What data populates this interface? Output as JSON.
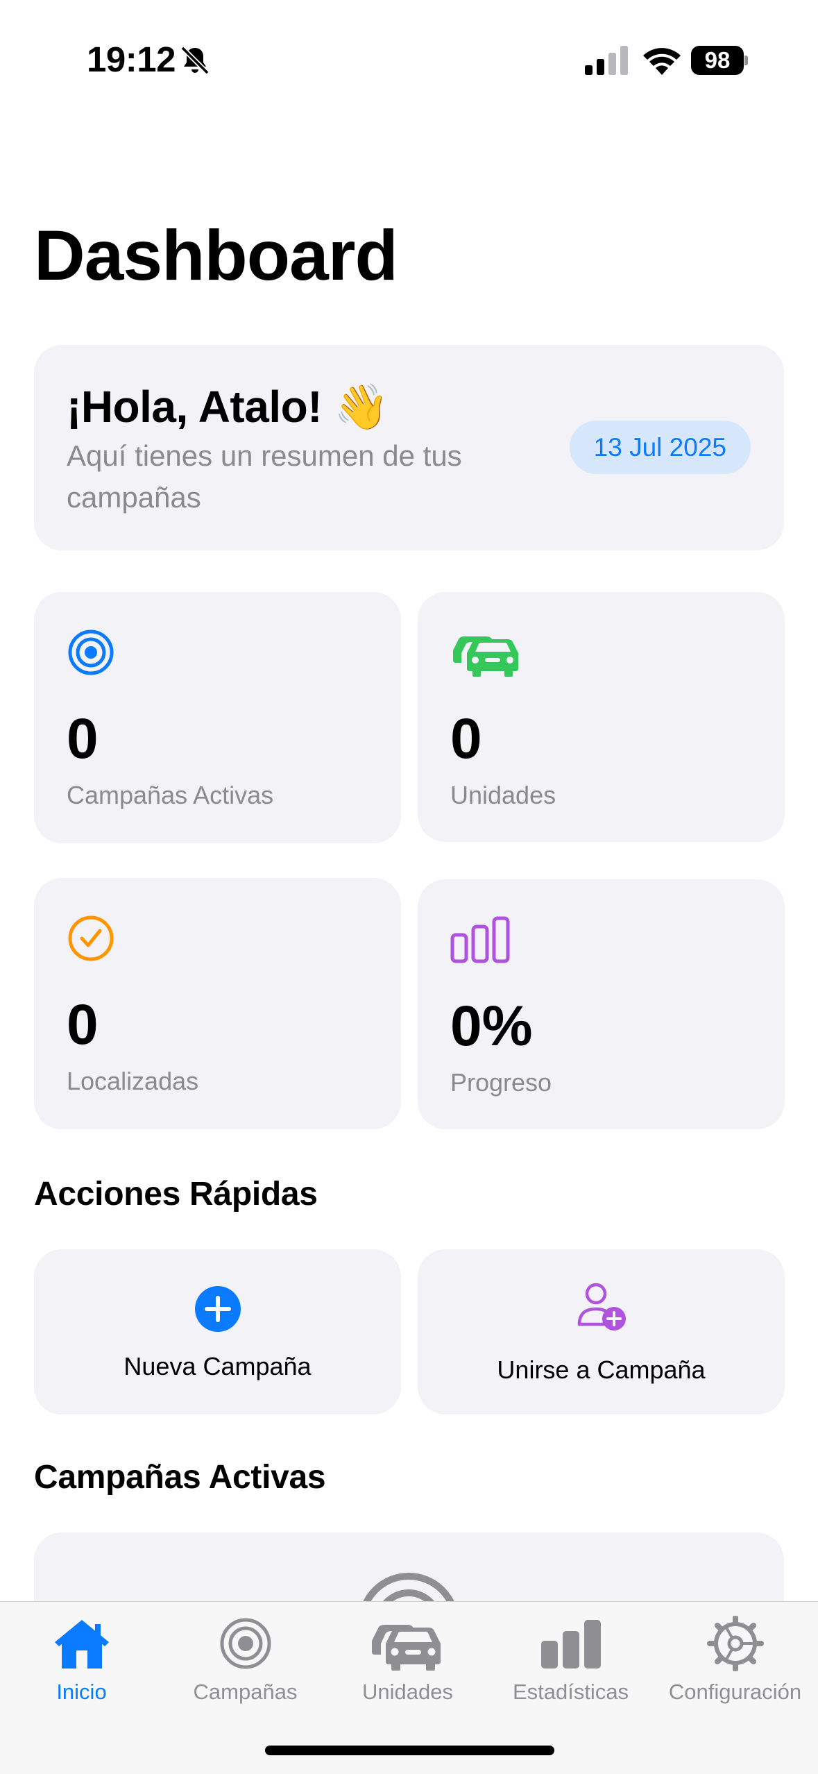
{
  "status_bar": {
    "time": "19:12",
    "battery": "98"
  },
  "title": "Dashboard",
  "greeting": {
    "title": "¡Hola, Atalo! 👋",
    "subtitle": "Aquí tienes un resumen de tus campañas",
    "date": "13 Jul 2025"
  },
  "stats": [
    {
      "value": "0",
      "label": "Campañas Activas",
      "icon": "target-icon",
      "color": "#0a7aff"
    },
    {
      "value": "0",
      "label": "Unidades",
      "icon": "cars-icon",
      "color": "#34c759"
    },
    {
      "value": "0",
      "label": "Localizadas",
      "icon": "checkmark-circle-icon",
      "color": "#ff9500"
    },
    {
      "value": "0%",
      "label": "Progreso",
      "icon": "bar-chart-icon",
      "color": "#af52de"
    }
  ],
  "quick_actions": {
    "title": "Acciones Rápidas",
    "items": [
      {
        "label": "Nueva Campaña",
        "icon": "plus-circle-icon"
      },
      {
        "label": "Unirse a Campaña",
        "icon": "person-add-icon"
      }
    ]
  },
  "active_campaigns": {
    "title": "Campañas Activas"
  },
  "tab_bar": {
    "tabs": [
      {
        "label": "Inicio",
        "icon": "house-icon",
        "active": true
      },
      {
        "label": "Campañas",
        "icon": "target-icon"
      },
      {
        "label": "Unidades",
        "icon": "cars-icon"
      },
      {
        "label": "Estadísticas",
        "icon": "bar-chart-icon"
      },
      {
        "label": "Configuración",
        "icon": "gear-icon"
      }
    ]
  },
  "colors": {
    "accent": "#0a7aff",
    "card_background": "#f2f2f7",
    "secondary_text": "#8a8a8e",
    "tab_inactive": "#8e8e93"
  }
}
